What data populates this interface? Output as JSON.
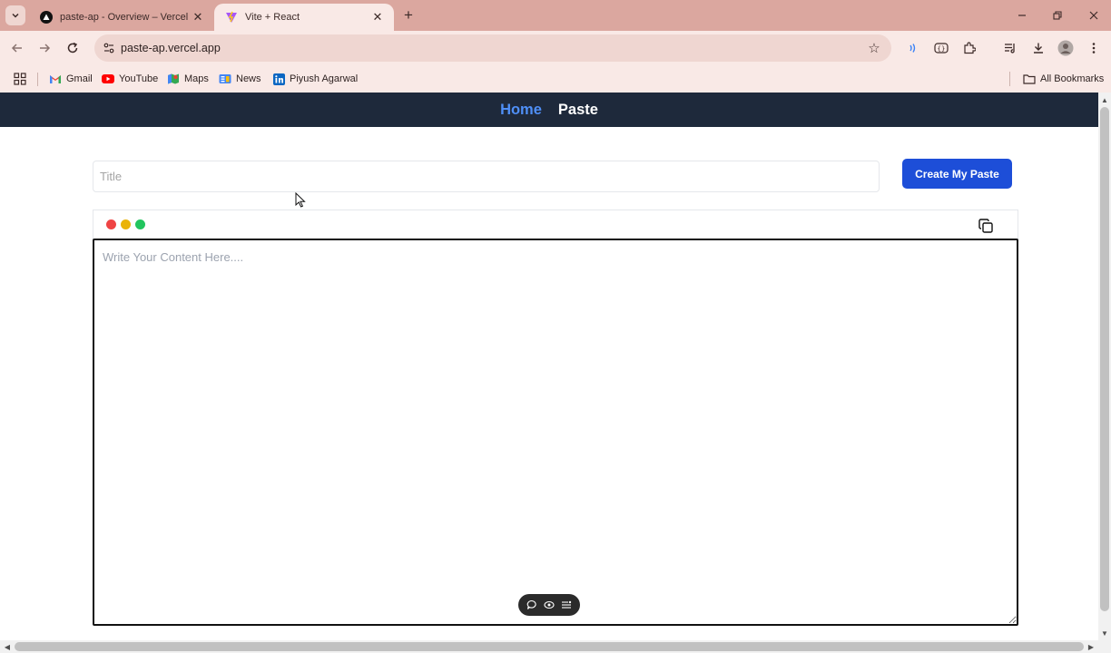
{
  "browser": {
    "tabs": [
      {
        "title": "paste-ap - Overview – Vercel",
        "favicon": "vercel-icon",
        "active": false
      },
      {
        "title": "Vite + React",
        "favicon": "vite-icon",
        "active": true
      }
    ],
    "url": "paste-ap.vercel.app",
    "bookmarks": [
      {
        "label": "Gmail",
        "icon": "gmail-icon"
      },
      {
        "label": "YouTube",
        "icon": "youtube-icon"
      },
      {
        "label": "Maps",
        "icon": "maps-icon"
      },
      {
        "label": "News",
        "icon": "news-icon"
      },
      {
        "label": "Piyush Agarwal",
        "icon": "linkedin-icon"
      }
    ],
    "all_bookmarks": "All Bookmarks"
  },
  "app": {
    "nav": {
      "home": "Home",
      "paste": "Paste"
    },
    "title_placeholder": "Title",
    "title_value": "",
    "create_button": "Create My Paste",
    "content_placeholder": "Write Your Content Here....",
    "content_value": ""
  },
  "colors": {
    "nav_bg": "#1e293b",
    "nav_active": "#4f8ff7",
    "button_bg": "#1d4ed8",
    "dot_red": "#ef4444",
    "dot_yellow": "#eab308",
    "dot_green": "#22c55e",
    "chrome_tabstrip": "#dba79f",
    "chrome_toolbar": "#f9e9e6"
  }
}
